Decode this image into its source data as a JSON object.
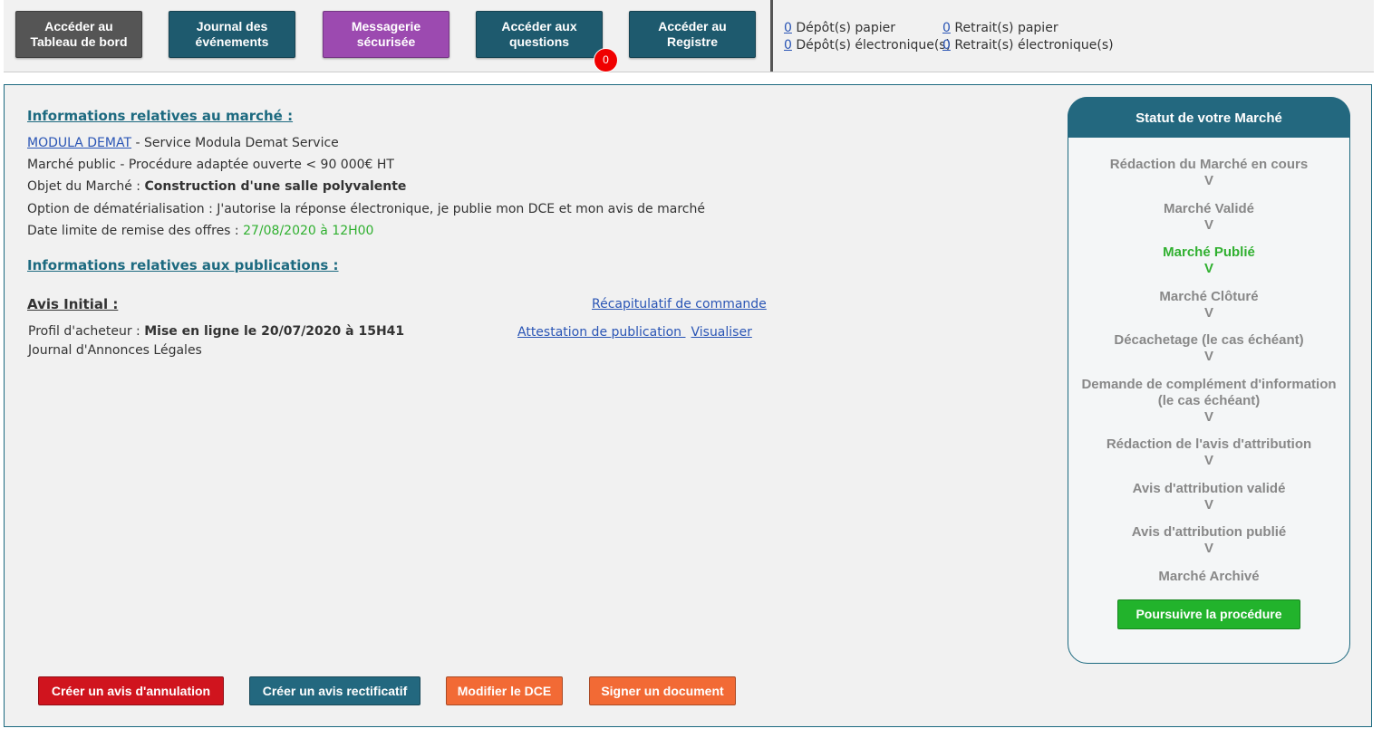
{
  "toolbar": {
    "buttons": [
      {
        "label": "Accéder au Tableau de bord"
      },
      {
        "label": "Journal des événements"
      },
      {
        "label": "Messagerie sécurisée"
      },
      {
        "label": "Accéder aux questions"
      },
      {
        "label": "Accéder au Registre"
      }
    ],
    "questions_badge": "0"
  },
  "stats": {
    "depot_papier_count": "0",
    "depot_papier_label": "Dépôt(s) papier",
    "depot_elec_count": "0",
    "depot_elec_label": "Dépôt(s) électronique(s)",
    "retrait_papier_count": "0",
    "retrait_papier_label": "Retrait(s) papier",
    "retrait_elec_count": "0",
    "retrait_elec_label": "Retrait(s) électronique(s)"
  },
  "marche": {
    "section_title": "Informations relatives au marché :",
    "buyer_link": "MODULA DEMAT",
    "buyer_rest": " - Service Modula Demat Service",
    "type": "Marché public - Procédure adaptée ouverte < 90 000€ HT",
    "objet_label": "Objet du Marché : ",
    "objet_value": "Construction d'une salle polyvalente",
    "option": "Option de dématérialisation : J'autorise la réponse électronique, je publie mon DCE et mon avis de marché",
    "date_label": "Date limite de remise des offres : ",
    "date_value": "27/08/2020 à 12H00"
  },
  "publications": {
    "section_title": "Informations relatives aux publications :",
    "avis_title": "Avis Initial :",
    "recap_link": "Récapitulatif de commande ",
    "profil_label": "Profil d'acheteur : ",
    "profil_value": "Mise en ligne le 20/07/2020 à 15H41",
    "attestation_link": "Attestation de publication ",
    "visualiser_link": "Visualiser",
    "journal": "Journal d'Annonces Légales"
  },
  "status_panel": {
    "title": "Statut de votre Marché",
    "steps": [
      {
        "label": "Rédaction du Marché en cours",
        "mark": "V"
      },
      {
        "label": "Marché Validé",
        "mark": "V"
      },
      {
        "label": "Marché Publié",
        "mark": "V"
      },
      {
        "label": "Marché Clôturé",
        "mark": "V"
      },
      {
        "label": "Décachetage (le cas échéant)",
        "mark": "V"
      },
      {
        "label": "Demande de complément d'information (le cas échéant)",
        "mark": "V"
      },
      {
        "label": "Rédaction de l'avis d'attribution",
        "mark": "V"
      },
      {
        "label": "Avis d'attribution validé",
        "mark": "V"
      },
      {
        "label": "Avis d'attribution publié",
        "mark": "V"
      },
      {
        "label": "Marché Archivé",
        "mark": ""
      }
    ],
    "active_step": "Marché Publié",
    "continue_button": "Poursuivre la procédure"
  },
  "actions": {
    "annulation": "Créer un avis d'annulation",
    "rectificatif": "Créer un avis rectificatif",
    "modifier_dce": "Modifier le DCE",
    "signer": "Signer un document"
  },
  "colors": {
    "primary_teal": "#23687f",
    "success_green": "#22b32c",
    "danger_red": "#d0141e",
    "warning_orange": "#f26a35",
    "messaging_purple": "#9c4ab0"
  }
}
